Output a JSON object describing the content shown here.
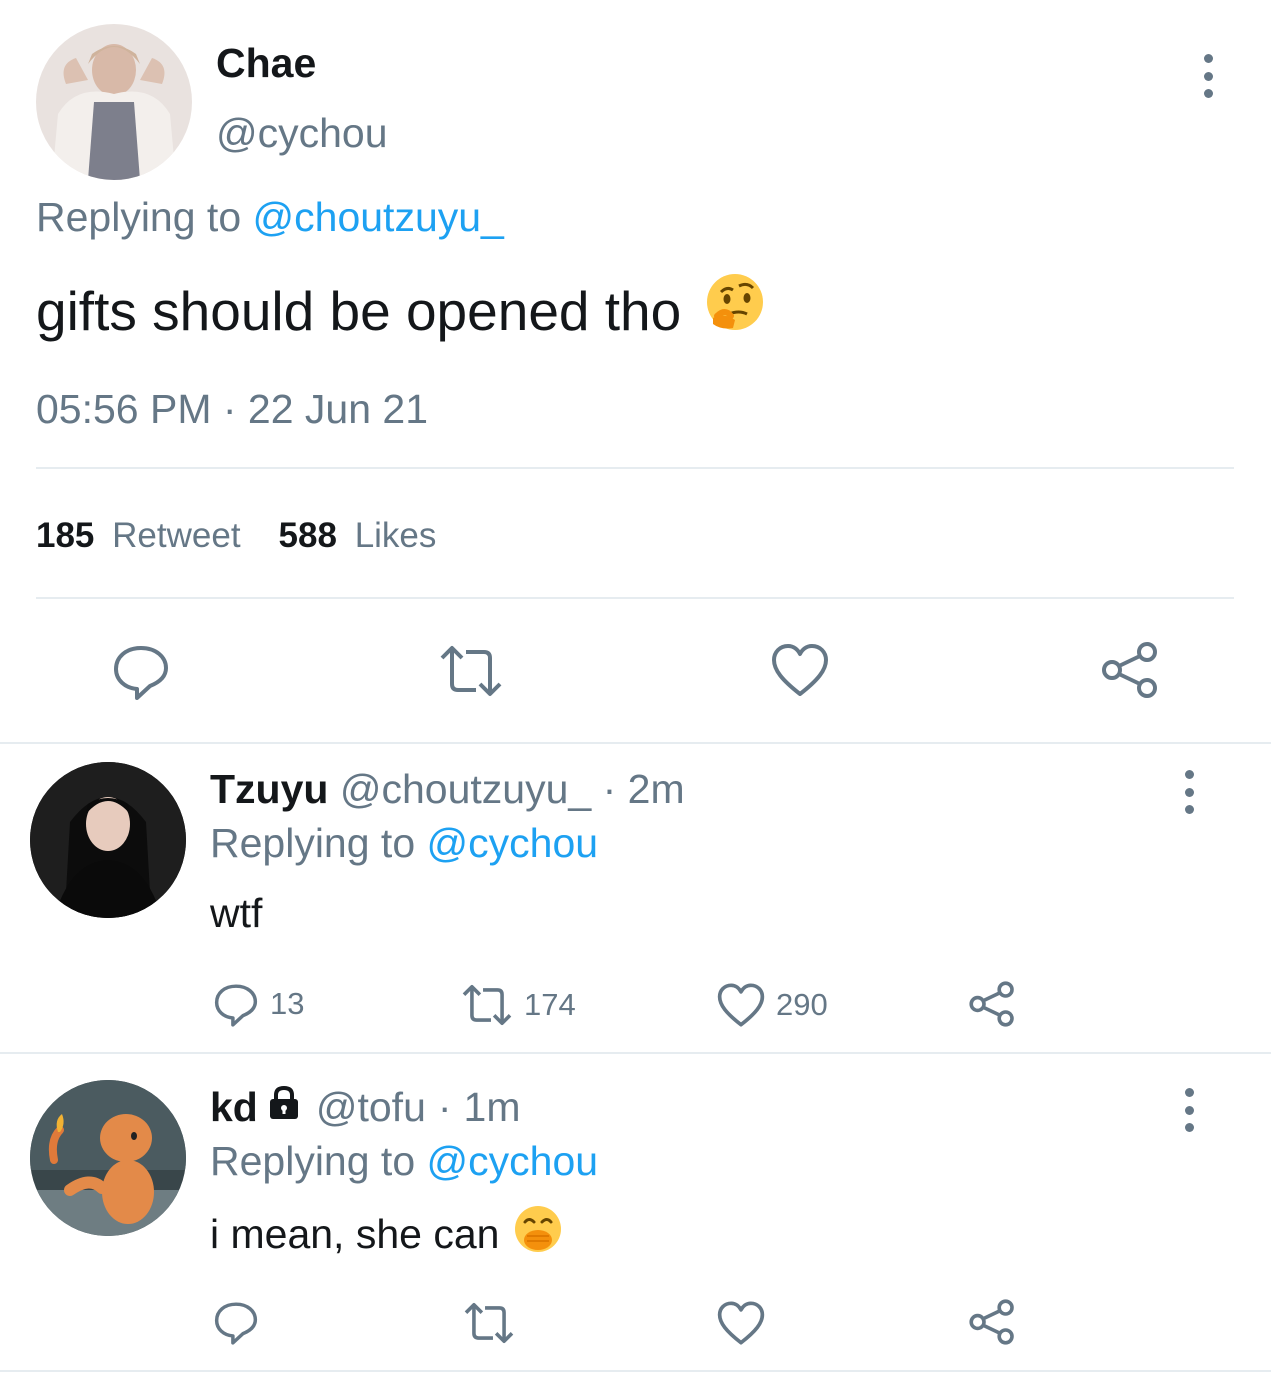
{
  "main_tweet": {
    "display_name": "Chae",
    "handle": "@cychou",
    "replying_prefix": "Replying to",
    "replying_handle": "@choutzuyu_",
    "text": "gifts should be opened tho",
    "emoji": "thinking-face",
    "timestamp": "05:56 PM · 22 Jun 21",
    "retweet_count": "185",
    "retweet_label": "Retweet",
    "likes_count": "588",
    "likes_label": "Likes"
  },
  "replies": [
    {
      "display_name": "Tzuyu",
      "handle": "@choutzuyu_",
      "separator": "·",
      "time": "2m",
      "replying_prefix": "Replying to",
      "replying_handle": "@cychou",
      "text": "wtf",
      "reply_count": "13",
      "retweet_count": "174",
      "like_count": "290"
    },
    {
      "display_name": "kd",
      "handle": "@tofu",
      "separator": "·",
      "time": "1m",
      "replying_prefix": "Replying to",
      "replying_handle": "@cychou",
      "text": "i mean, she can",
      "emoji": "hand-over-mouth-face",
      "protected": true
    }
  ],
  "colors": {
    "link": "#1da1f2",
    "secondary_text": "#657786",
    "divider": "#e6ecf0",
    "icon": "#657786"
  }
}
